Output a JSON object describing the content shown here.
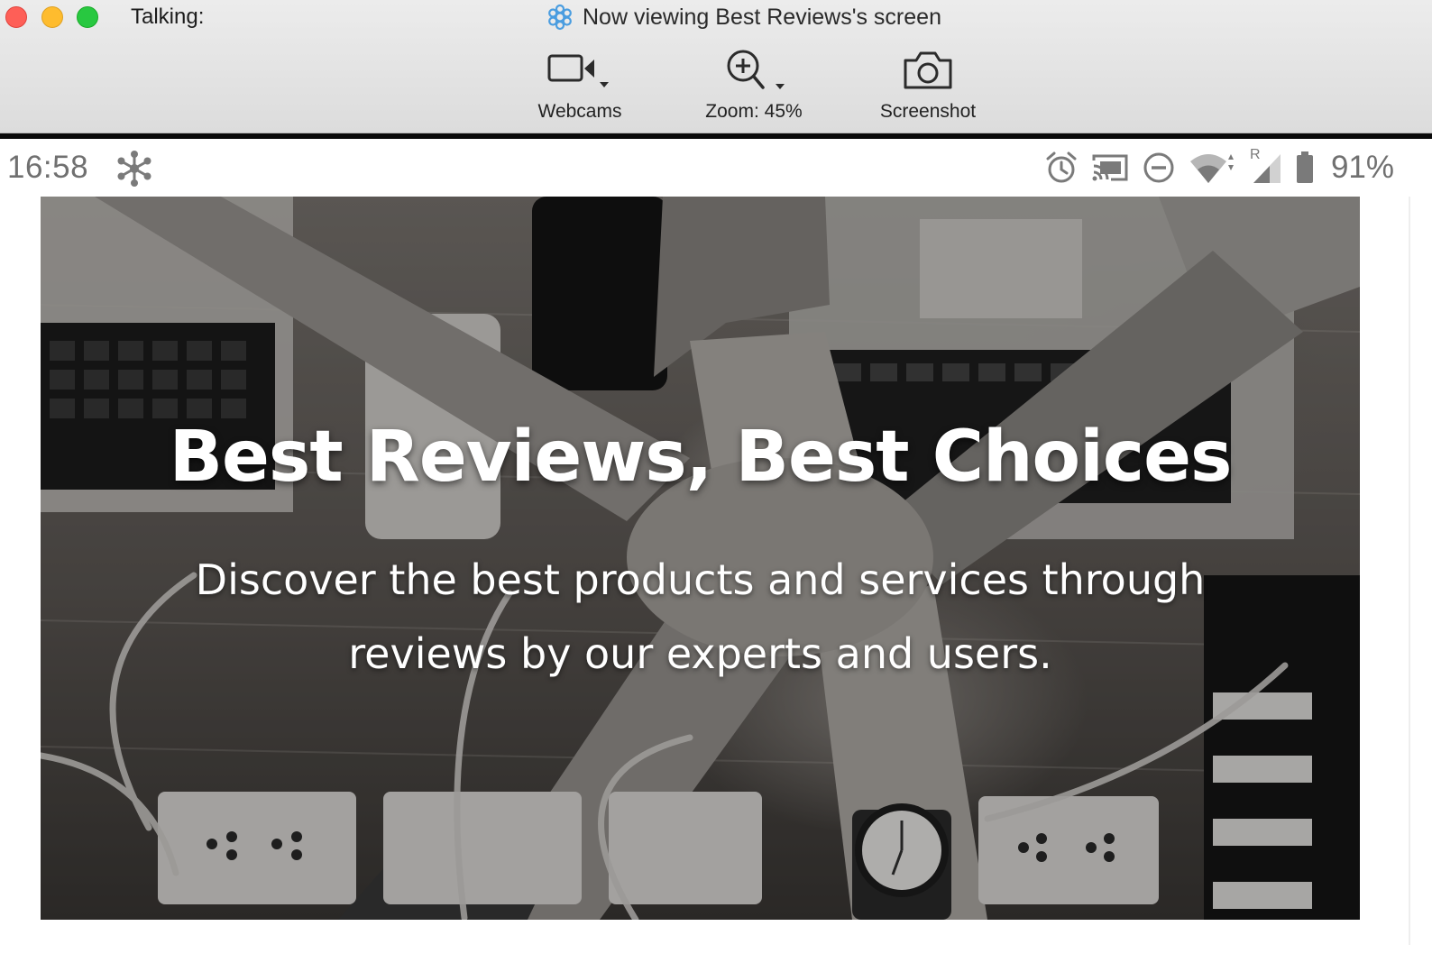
{
  "window": {
    "talking_label": "Talking:",
    "title": "Now viewing Best Reviews's screen",
    "toolbar": {
      "webcams_label": "Webcams",
      "zoom_label": "Zoom: 45%",
      "screenshot_label": "Screenshot"
    }
  },
  "device": {
    "status_bar": {
      "time": "16:58",
      "battery_percent": "91%",
      "signal_indicator": "R",
      "icons": [
        "snowflake-icon",
        "alarm-icon",
        "cast-icon",
        "do-not-disturb-icon",
        "wifi-icon",
        "signal-icon",
        "battery-icon"
      ]
    }
  },
  "hero": {
    "headline": "Best Reviews, Best Choices",
    "subtitle_line1": "Discover the best products and services through",
    "subtitle_line2": "reviews by our experts and users."
  },
  "colors": {
    "close": "#fe5f57",
    "minimize": "#febc2e",
    "zoom": "#28c840",
    "app_icon": "#4a9de0"
  }
}
